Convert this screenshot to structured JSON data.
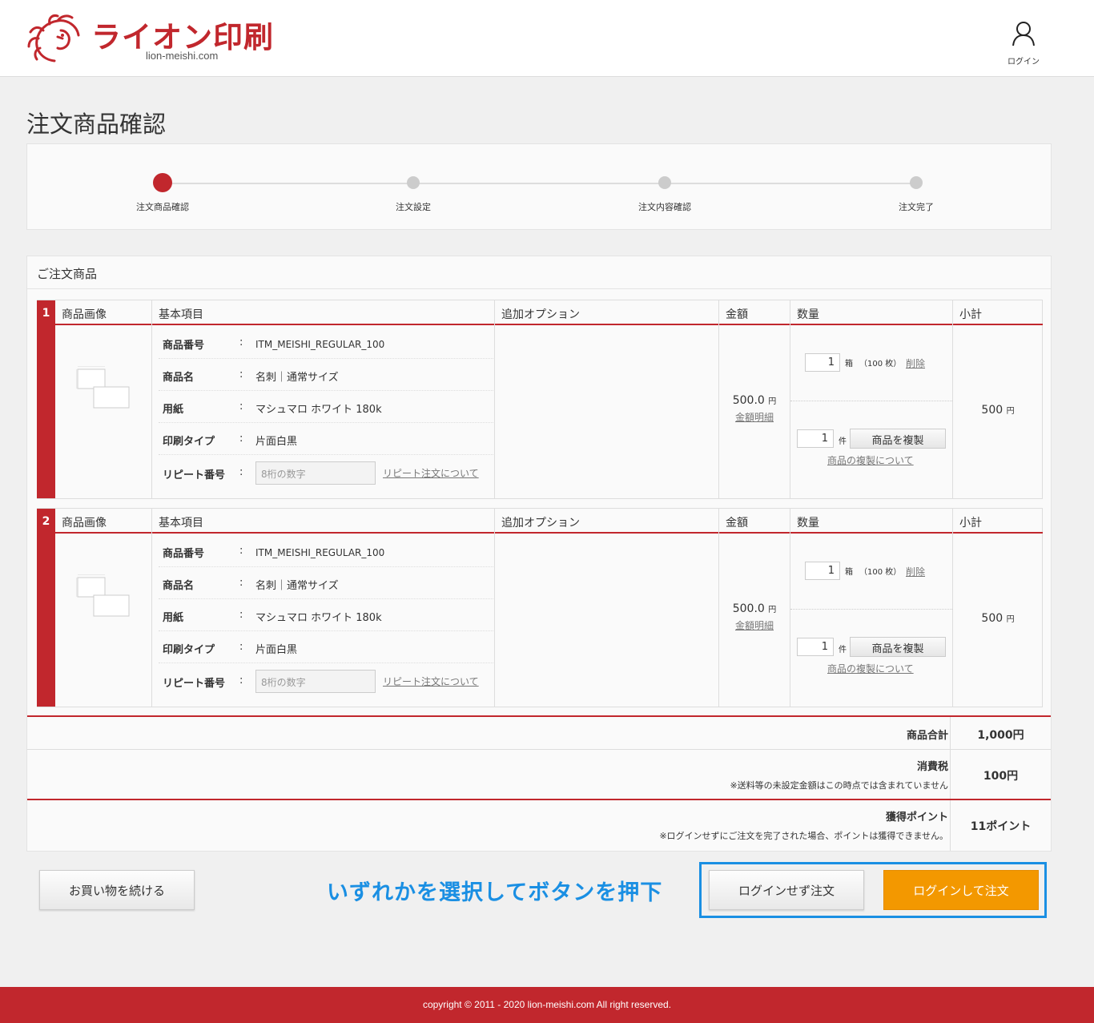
{
  "brand": {
    "name": "ライオン印刷",
    "domain": "lion-meishi.com",
    "color": "#c1272d"
  },
  "header": {
    "login_label": "ログイン"
  },
  "page_title": "注文商品確認",
  "steps": [
    {
      "label": "注文商品確認",
      "active": true
    },
    {
      "label": "注文設定",
      "active": false
    },
    {
      "label": "注文内容確認",
      "active": false
    },
    {
      "label": "注文完了",
      "active": false
    }
  ],
  "order": {
    "section_title": "ご注文商品",
    "columns": {
      "image": "商品画像",
      "basic": "基本項目",
      "options": "追加オプション",
      "price": "金額",
      "qty": "数量",
      "subtotal": "小計"
    },
    "field_labels": {
      "item_no": "商品番号",
      "name": "商品名",
      "paper": "用紙",
      "print_type": "印刷タイプ",
      "repeat_no": "リピート番号"
    },
    "colon": ":",
    "repeat_placeholder": "8桁の数字",
    "repeat_link": "リピート注文について",
    "price_detail_link": "金額明細",
    "delete_link": "削除",
    "copy_button": "商品を複製",
    "copy_link": "商品の複製について",
    "items": [
      {
        "num": "1",
        "item_no": "ITM_MEISHI_REGULAR_100",
        "name": "名刺｜通常サイズ",
        "paper": "マシュマロ ホワイト 180k",
        "print_type": "片面白黒",
        "price": "500.0",
        "price_unit": "円",
        "qty": "1",
        "qty_unit": "箱",
        "qty_sheets": "（100 枚）",
        "copies": "1",
        "copies_unit": "件",
        "subtotal": "500",
        "subtotal_unit": "円"
      },
      {
        "num": "2",
        "item_no": "ITM_MEISHI_REGULAR_100",
        "name": "名刺｜通常サイズ",
        "paper": "マシュマロ ホワイト 180k",
        "print_type": "片面白黒",
        "price": "500.0",
        "price_unit": "円",
        "qty": "1",
        "qty_unit": "箱",
        "qty_sheets": "（100 枚）",
        "copies": "1",
        "copies_unit": "件",
        "subtotal": "500",
        "subtotal_unit": "円"
      }
    ]
  },
  "summary": {
    "goods_total_label": "商品合計",
    "goods_total": "1,000円",
    "tax_label": "消費税",
    "tax_note": "※送料等の未設定金額はこの時点では含まれていません",
    "tax": "100円",
    "points_label": "獲得ポイント",
    "points_note": "※ログインせずにご注文を完了された場合、ポイントは獲得できません。",
    "points": "11ポイント"
  },
  "actions": {
    "continue_shopping": "お買い物を続ける",
    "order_without_login": "ログインせず注文",
    "order_with_login": "ログインして注文",
    "annotation": "いずれかを選択してボタンを押下"
  },
  "footer": {
    "copyright": "copyright © 2011 - 2020 lion-meishi.com All right reserved."
  },
  "colors": {
    "accent": "#c1272d",
    "orange": "#f39800",
    "annotation_blue": "#1a8fe3"
  }
}
